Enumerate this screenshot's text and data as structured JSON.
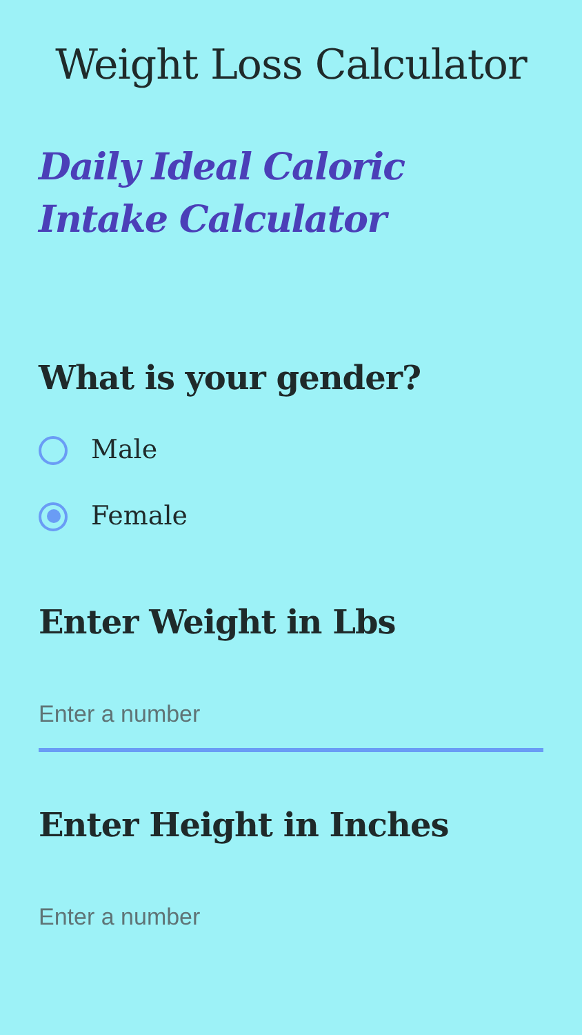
{
  "header": {
    "title": "Weight Loss Calculator"
  },
  "subtitle": "Daily Ideal Caloric Intake Calculator",
  "gender": {
    "question": "What is your gender?",
    "options": [
      {
        "label": "Male",
        "selected": false
      },
      {
        "label": "Female",
        "selected": true
      }
    ]
  },
  "fields": [
    {
      "label": "Enter Weight in Lbs",
      "placeholder": "Enter a number",
      "focused": true
    },
    {
      "label": "Enter Height in Inches",
      "placeholder": "Enter a number",
      "focused": false
    }
  ]
}
